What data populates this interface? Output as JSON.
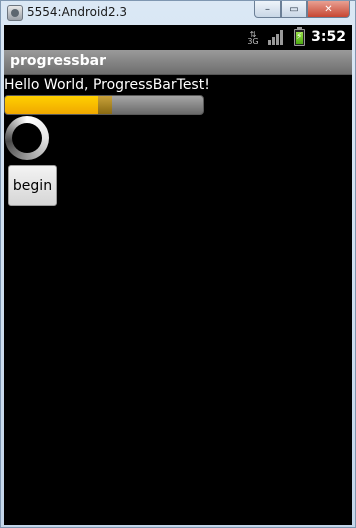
{
  "window": {
    "title": "5554:Android2.3",
    "minimize_glyph": "–",
    "maximize_glyph": "▭",
    "close_glyph": "✕"
  },
  "statusbar": {
    "network_label": "3G",
    "time": "3:52",
    "icons": [
      "data-arrows-icon",
      "signal-icon",
      "battery-charging-icon"
    ]
  },
  "app": {
    "title": "progressbar"
  },
  "content": {
    "hello_text": "Hello World, ProgressBarTest!",
    "progress": {
      "primary": 0.47,
      "secondary": 0.54
    },
    "begin_label": "begin"
  }
}
